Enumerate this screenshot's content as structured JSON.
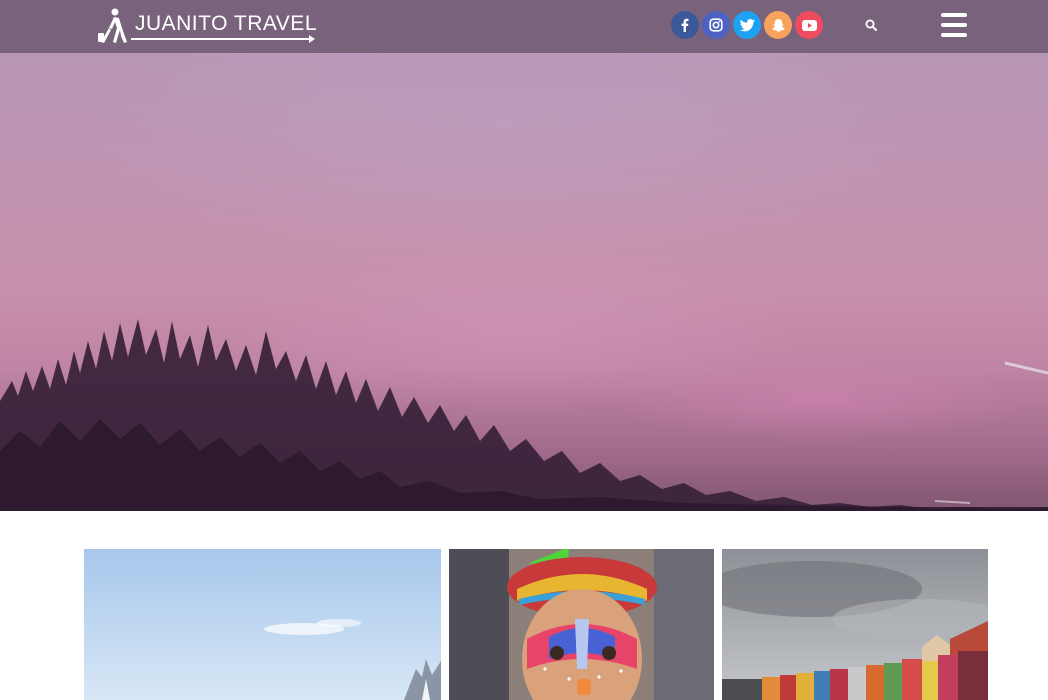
{
  "header": {
    "logo_text": "JUANITO TRAVEL",
    "social_links": [
      {
        "icon": "facebook-icon",
        "color": "#3b5998"
      },
      {
        "icon": "instagram-icon",
        "color": "#4c63c4"
      },
      {
        "icon": "twitter-icon",
        "color": "#1da1f2"
      },
      {
        "icon": "snapchat-icon",
        "color": "#f7a35c"
      },
      {
        "icon": "youtube-icon",
        "color": "#f04b5e"
      }
    ],
    "search_icon": "search-icon",
    "menu_icon": "hamburger-menu-icon"
  },
  "hero": {
    "description_icon": "sunset-sky-over-treeline"
  },
  "cards": [
    {
      "icon": "mountain-sky-photo"
    },
    {
      "icon": "face-painted-child-photo"
    },
    {
      "icon": "colorful-harbor-houses-photo"
    }
  ]
}
